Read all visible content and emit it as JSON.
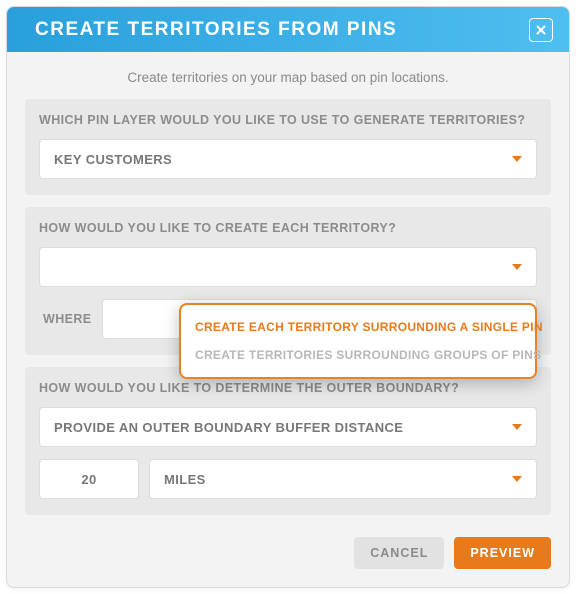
{
  "header": {
    "title": "CREATE TERRITORIES FROM PINS"
  },
  "subtitle": "Create territories on your map based on pin locations.",
  "sections": {
    "pinLayer": {
      "label": "WHICH PIN LAYER WOULD YOU LIKE TO USE TO GENERATE TERRITORIES?",
      "value": "KEY CUSTOMERS"
    },
    "createMethod": {
      "label": "HOW WOULD YOU LIKE TO CREATE EACH TERRITORY?",
      "value": "",
      "whereLabel": "WHERE",
      "options": [
        "CREATE EACH TERRITORY SURROUNDING A SINGLE PIN",
        "CREATE TERRITORIES SURROUNDING GROUPS OF PINS"
      ]
    },
    "boundary": {
      "label": "HOW WOULD YOU LIKE TO DETERMINE THE OUTER BOUNDARY?",
      "value": "PROVIDE AN OUTER BOUNDARY BUFFER DISTANCE",
      "distance": "20",
      "unit": "MILES"
    }
  },
  "footer": {
    "cancel": "CANCEL",
    "preview": "PREVIEW"
  }
}
